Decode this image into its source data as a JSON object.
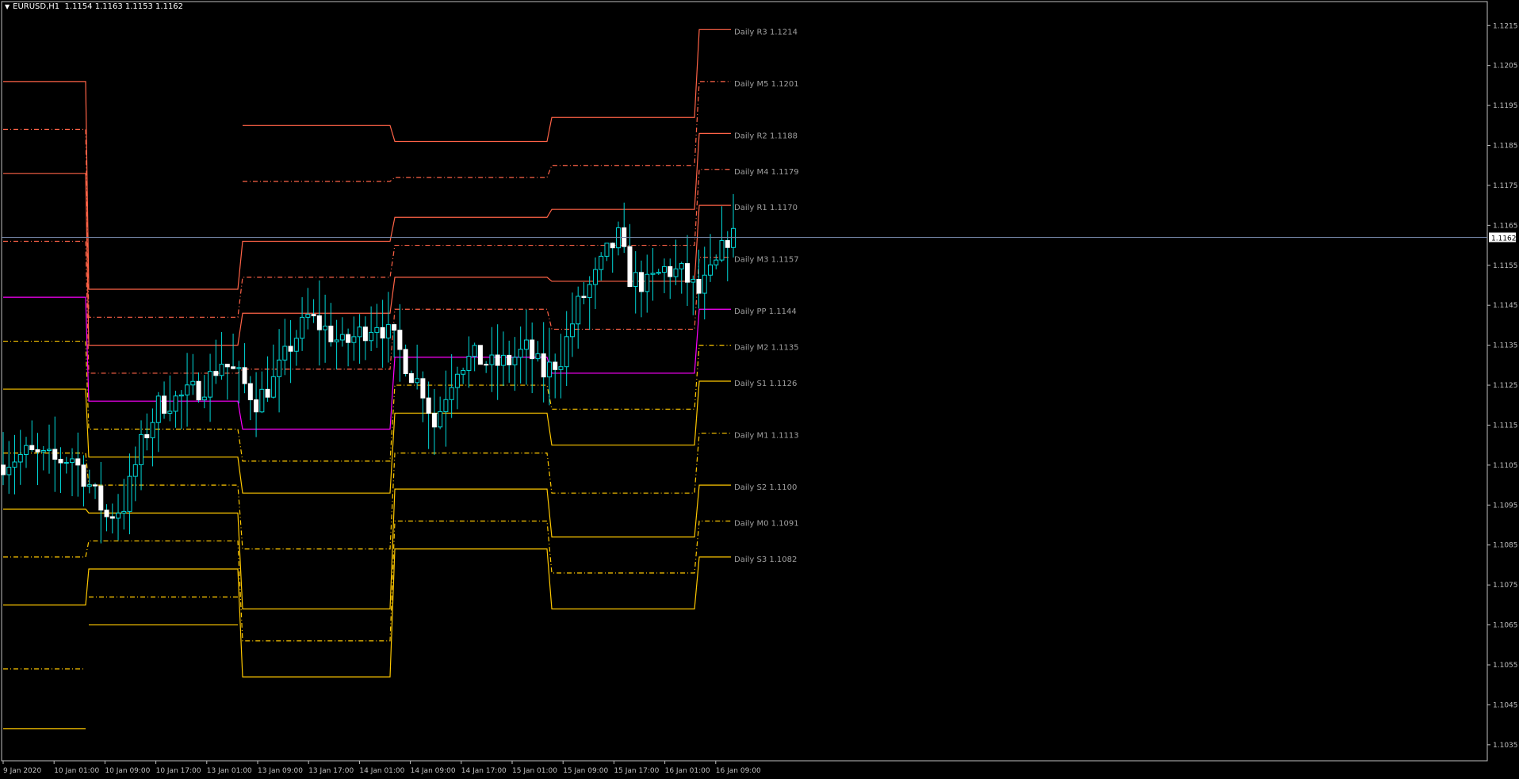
{
  "header": {
    "symbol": "EURUSD,H1",
    "ohlc": "1.1154 1.1163 1.1153 1.1162"
  },
  "colors": {
    "background": "#000000",
    "frame": "#c0c0c0",
    "text": "#c0c0c0",
    "candle_up": "#ffffff",
    "candle_down": "#00d8d8",
    "resistance": "#ff6347",
    "pivot": "#ff00ff",
    "support": "#ffc800",
    "bid_line": "#7788aa",
    "level_label": "#a0a0a0"
  },
  "chart_data": {
    "type": "candlestick",
    "symbol": "EURUSD",
    "timeframe": "H1",
    "current_price": 1.1162,
    "ylim": [
      1.1031,
      1.1221
    ],
    "y_ticks": [
      "1.1215",
      "1.1205",
      "1.1195",
      "1.1185",
      "1.1175",
      "1.1165",
      "1.1155",
      "1.1145",
      "1.1135",
      "1.1125",
      "1.1115",
      "1.1105",
      "1.1095",
      "1.1085",
      "1.1075",
      "1.1065",
      "1.1055",
      "1.1045",
      "1.1035"
    ],
    "bid_label": "1.1162",
    "x_labels": [
      "9 Jan 2020",
      "10 Jan 01:00",
      "10 Jan 09:00",
      "10 Jan 17:00",
      "13 Jan 01:00",
      "13 Jan 09:00",
      "13 Jan 17:00",
      "14 Jan 01:00",
      "14 Jan 09:00",
      "14 Jan 17:00",
      "15 Jan 01:00",
      "15 Jan 09:00",
      "15 Jan 17:00",
      "16 Jan 01:00",
      "16 Jan 09:00"
    ],
    "bar_count": 128,
    "day_segments": [
      {
        "levels": {
          "R3": null,
          "M5": null,
          "R2": 1.1201,
          "M4": 1.1189,
          "R1": 1.1178,
          "M3": 1.1161,
          "PP": 1.1147,
          "M2": 1.1136,
          "S1": 1.1124,
          "M1": 1.1108,
          "S2": 1.1094,
          "M0": 1.1082,
          "S3": 1.107
        },
        "extra_lower": [
          1.1054,
          1.1039
        ]
      },
      {
        "levels": {
          "R3": null,
          "M5": null,
          "R2": 1.1149,
          "M4": 1.1142,
          "R1": 1.1135,
          "M3": 1.1128,
          "PP": 1.1121,
          "M2": 1.1114,
          "S1": 1.1107,
          "M1": 1.11,
          "S2": 1.1093,
          "M0": 1.1086,
          "S3": 1.1079
        },
        "extra_lower": [
          1.1072,
          1.1065
        ]
      },
      {
        "levels": {
          "R3": 1.119,
          "M5": 1.1176,
          "R2": 1.1161,
          "M4": 1.1152,
          "R1": 1.1143,
          "M3": 1.1129,
          "PP": 1.1114,
          "M2": 1.1106,
          "S1": 1.1098,
          "M1": 1.1084,
          "S2": 1.1069,
          "M0": 1.1061,
          "S3": 1.1052
        },
        "extra_lower": []
      },
      {
        "levels": {
          "R3": 1.1186,
          "M5": 1.1177,
          "R2": 1.1167,
          "M4": 1.116,
          "R1": 1.1152,
          "M3": 1.1144,
          "PP": 1.1132,
          "M2": 1.1125,
          "S1": 1.1118,
          "M1": 1.1108,
          "S2": 1.1099,
          "M0": 1.1091,
          "S3": 1.1084
        },
        "extra_lower": []
      },
      {
        "levels": {
          "R3": 1.1192,
          "M5": 1.118,
          "R2": 1.1169,
          "M4": 1.116,
          "R1": 1.1151,
          "M3": 1.1139,
          "PP": 1.1128,
          "M2": 1.1119,
          "S1": 1.111,
          "M1": 1.1098,
          "S2": 1.1087,
          "M0": 1.1078,
          "S3": 1.1069
        },
        "extra_lower": []
      },
      {
        "levels": {
          "R3": 1.1214,
          "M5": 1.1201,
          "R2": 1.1188,
          "M4": 1.1179,
          "R1": 1.117,
          "M3": 1.1157,
          "PP": 1.1144,
          "M2": 1.1135,
          "S1": 1.1126,
          "M1": 1.1113,
          "S2": 1.11,
          "M0": 1.1091,
          "S3": 1.1082
        },
        "extra_lower": []
      }
    ],
    "level_labels": [
      {
        "key": "R3",
        "text": "Daily R3 1.1214",
        "value": 1.1214,
        "style": "solid",
        "group": "resistance"
      },
      {
        "key": "M5",
        "text": "Daily M5 1.1201",
        "value": 1.1201,
        "style": "dash",
        "group": "resistance"
      },
      {
        "key": "R2",
        "text": "Daily R2 1.1188",
        "value": 1.1188,
        "style": "solid",
        "group": "resistance"
      },
      {
        "key": "M4",
        "text": "Daily M4 1.1179",
        "value": 1.1179,
        "style": "dash",
        "group": "resistance"
      },
      {
        "key": "R1",
        "text": "Daily R1 1.1170",
        "value": 1.117,
        "style": "solid",
        "group": "resistance"
      },
      {
        "key": "M3",
        "text": "Daily M3 1.1157",
        "value": 1.1157,
        "style": "dash",
        "group": "resistance"
      },
      {
        "key": "PP",
        "text": "Daily PP 1.1144",
        "value": 1.1144,
        "style": "solid",
        "group": "pivot"
      },
      {
        "key": "M2",
        "text": "Daily M2 1.1135",
        "value": 1.1135,
        "style": "dash",
        "group": "support"
      },
      {
        "key": "S1",
        "text": "Daily S1 1.1126",
        "value": 1.1126,
        "style": "solid",
        "group": "support"
      },
      {
        "key": "M1",
        "text": "Daily M1 1.1113",
        "value": 1.1113,
        "style": "dash",
        "group": "support"
      },
      {
        "key": "S2",
        "text": "Daily S2 1.1100",
        "value": 1.11,
        "style": "solid",
        "group": "support"
      },
      {
        "key": "M0",
        "text": "Daily M0 1.1091",
        "value": 1.1091,
        "style": "dash",
        "group": "support"
      },
      {
        "key": "S3",
        "text": "Daily S3 1.1082",
        "value": 1.1082,
        "style": "solid",
        "group": "support"
      }
    ],
    "path_anchors": [
      [
        0,
        1.1105
      ],
      [
        5,
        1.1108
      ],
      [
        10,
        1.1106
      ],
      [
        13,
        1.1107
      ],
      [
        16,
        1.11
      ],
      [
        19,
        1.1092
      ],
      [
        22,
        1.1095
      ],
      [
        25,
        1.111
      ],
      [
        28,
        1.112
      ],
      [
        32,
        1.1122
      ],
      [
        36,
        1.1125
      ],
      [
        39,
        1.1131
      ],
      [
        42,
        1.1127
      ],
      [
        45,
        1.1121
      ],
      [
        48,
        1.1126
      ],
      [
        51,
        1.1135
      ],
      [
        54,
        1.1142
      ],
      [
        57,
        1.1139
      ],
      [
        60,
        1.1135
      ],
      [
        63,
        1.1138
      ],
      [
        66,
        1.1141
      ],
      [
        69,
        1.1136
      ],
      [
        72,
        1.1128
      ],
      [
        74,
        1.1124
      ],
      [
        76,
        1.1115
      ],
      [
        78,
        1.1123
      ],
      [
        80,
        1.113
      ],
      [
        83,
        1.1132
      ],
      [
        86,
        1.113
      ],
      [
        89,
        1.1131
      ],
      [
        92,
        1.1134
      ],
      [
        95,
        1.1128
      ],
      [
        98,
        1.1132
      ],
      [
        101,
        1.1145
      ],
      [
        104,
        1.1152
      ],
      [
        106,
        1.1158
      ],
      [
        108,
        1.1162
      ],
      [
        110,
        1.1152
      ],
      [
        113,
        1.115
      ],
      [
        116,
        1.1154
      ],
      [
        119,
        1.1153
      ],
      [
        122,
        1.1148
      ],
      [
        125,
        1.1155
      ],
      [
        127,
        1.1162
      ]
    ]
  }
}
